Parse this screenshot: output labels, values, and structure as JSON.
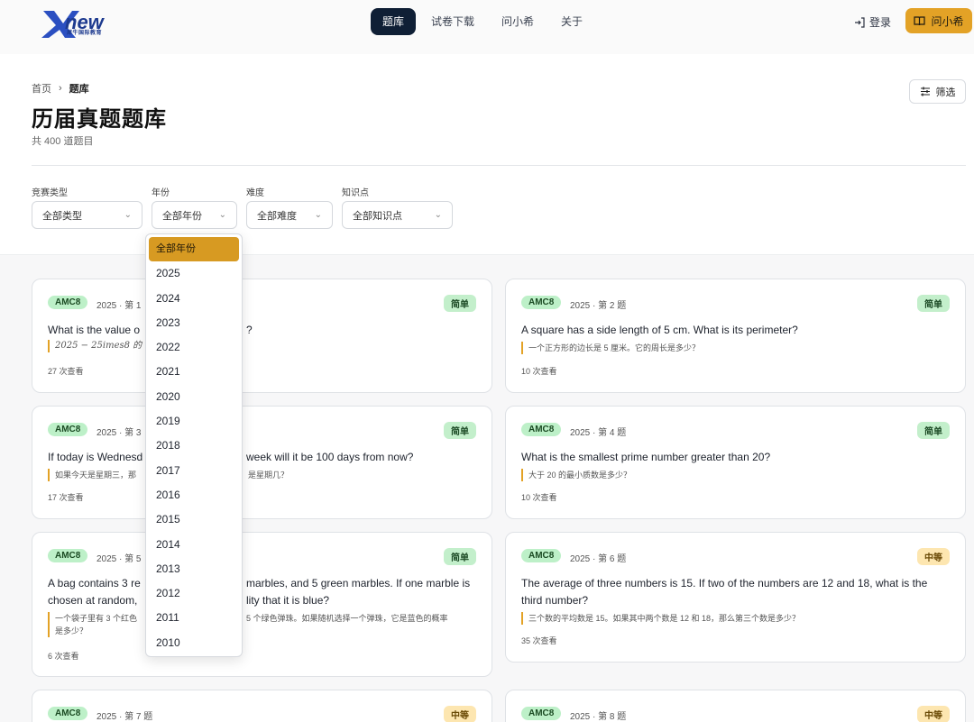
{
  "header": {
    "logo_text": "new",
    "logo_sub": "犀牛国际教育",
    "nav": [
      {
        "label": "题库",
        "active": true
      },
      {
        "label": "试卷下载",
        "active": false
      },
      {
        "label": "问小希",
        "active": false
      },
      {
        "label": "关于",
        "active": false
      }
    ],
    "login_label": "登录",
    "ask_label": "问小希",
    "accent_color": "#e3a226"
  },
  "breadcrumb": {
    "home": "首页",
    "current": "题库"
  },
  "page": {
    "title": "历届真题题库",
    "count": "共 400 道题目",
    "filter_button": "筛选"
  },
  "filters": {
    "type": {
      "label": "竞赛类型",
      "value": "全部类型"
    },
    "year": {
      "label": "年份",
      "value": "全部年份"
    },
    "difficulty": {
      "label": "难度",
      "value": "全部难度"
    },
    "topic": {
      "label": "知识点",
      "value": "全部知识点"
    }
  },
  "year_dropdown": {
    "options": [
      "全部年份",
      "2025",
      "2024",
      "2023",
      "2022",
      "2021",
      "2020",
      "2019",
      "2018",
      "2017",
      "2016",
      "2015",
      "2014",
      "2013",
      "2012",
      "2011",
      "2010"
    ],
    "selected": "全部年份"
  },
  "cards": [
    {
      "tag": "AMC8",
      "meta": "2025 · 第 1",
      "difficulty": "简单",
      "q_en": "What is the value of 2025 − 25 × 8?",
      "q_en_left": "What is the value o",
      "q_en_right": "?",
      "q_cn": "2025 − 25imes8 的值是多少？",
      "q_cn_left": "2025 − 25imes8 的",
      "views": "27 次查看"
    },
    {
      "tag": "AMC8",
      "meta": "2025 · 第 2 题",
      "difficulty": "简单",
      "q_en": "A square has a side length of 5 cm. What is its perimeter?",
      "q_cn": "一个正方形的边长是 5 厘米。它的周长是多少？",
      "views": "10 次查看"
    },
    {
      "tag": "AMC8",
      "meta": "2025 · 第 3",
      "difficulty": "简单",
      "q_en_left": "If today is Wednesd",
      "q_en_right": "week will it be 100 days from now?",
      "q_cn_left": "如果今天是星期三，那",
      "q_cn_right": "是星期几？",
      "views": "17 次查看"
    },
    {
      "tag": "AMC8",
      "meta": "2025 · 第 4 题",
      "difficulty": "简单",
      "q_en": "What is the smallest prime number greater than 20?",
      "q_cn": "大于 20 的最小质数是多少？",
      "views": "10 次查看"
    },
    {
      "tag": "AMC8",
      "meta": "2025 · 第 5",
      "difficulty": "简单",
      "q_en_l1_left": "A bag contains 3 re",
      "q_en_l1_right": "marbles, and 5 green marbles. If one marble is",
      "q_en_l2_left": "chosen at random,",
      "q_en_l2_right": "lity that it is blue?",
      "q_cn_l1_left": "一个袋子里有 3 个红色",
      "q_cn_l1_right": "5 个绿色弹珠。如果随机选择一个弹珠，它是蓝色的概率",
      "q_cn_l2": "是多少？",
      "views": "6 次查看"
    },
    {
      "tag": "AMC8",
      "meta": "2025 · 第 6 题",
      "difficulty": "中等",
      "q_en": "The average of three numbers is 15. If two of the numbers are 12 and 18, what is the third number?",
      "q_cn": "三个数的平均数是 15。如果其中两个数是 12 和 18，那么第三个数是多少？",
      "views": "35 次查看"
    },
    {
      "tag": "AMC8",
      "meta": "2025 · 第 7 题",
      "difficulty": "中等"
    },
    {
      "tag": "AMC8",
      "meta": "2025 · 第 8 题",
      "difficulty": "中等"
    }
  ]
}
